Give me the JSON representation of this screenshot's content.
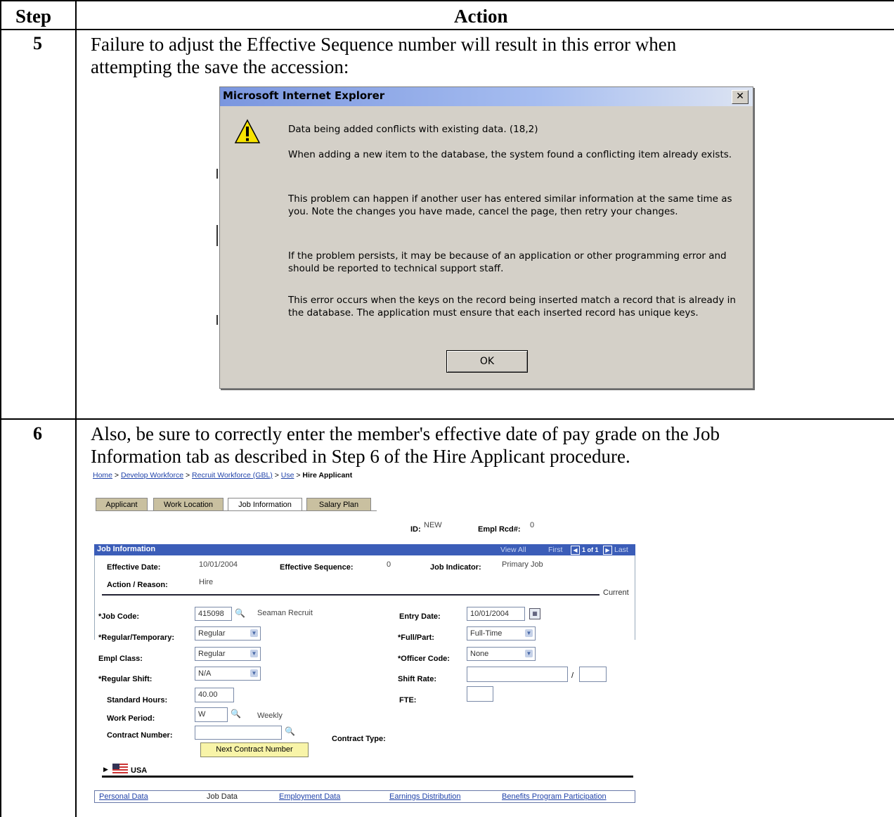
{
  "table": {
    "header_step": "Step",
    "header_action": "Action"
  },
  "row5": {
    "step": "5",
    "text_line1": "Failure to adjust the Effective Sequence number will result in this error when",
    "text_line2": "attempting the save the accession:"
  },
  "dialog": {
    "title": "Microsoft Internet Explorer",
    "close": "✕",
    "icon": "warning-icon",
    "p1": "Data being added conflicts with existing data. (18,2)",
    "p2": "When adding a new item to the database, the system found a conflicting item already exists.",
    "p3": "This problem can happen if another user has entered similar information at the same time as you.  Note the changes you have made, cancel the page, then retry your changes.",
    "p4": "If the problem persists, it may be because of an application or other programming error and should be reported to technical support staff.",
    "p5": "This error occurs when the keys on the record being inserted match a record that is already in the database.  The application must ensure that each inserted record has unique keys.",
    "ok": "OK"
  },
  "row6": {
    "step": "6",
    "text_line1": "Also, be sure to correctly enter the member's effective date of pay grade on the Job",
    "text_line2": "Information tab as described in Step 6 of the Hire Applicant procedure."
  },
  "ps": {
    "breadcrumb": {
      "home": "Home",
      "sep": " > ",
      "develop": "Develop Workforce",
      "recruit": "Recruit Workforce (GBL)",
      "use": "Use",
      "current": "Hire Applicant"
    },
    "tabs": [
      "Applicant",
      "Work Location",
      "Job Information",
      "Salary Plan"
    ],
    "id_label": "ID:",
    "id_value": "NEW",
    "rcd_label": "Empl Rcd#:",
    "rcd_value": "0",
    "section_title": "Job Information",
    "nav": {
      "view_all": "View All",
      "first": "First",
      "count": "1 of 1",
      "last": "Last"
    },
    "eff_date_label": "Effective Date:",
    "eff_date_value": "10/01/2004",
    "eff_seq_label": "Effective Sequence:",
    "eff_seq_value": "0",
    "job_ind_label": "Job Indicator:",
    "job_ind_value": "Primary Job",
    "action_label": "Action / Reason:",
    "action_value": "Hire",
    "current": "Current",
    "job_code_label": "*Job Code:",
    "job_code_value": "415098",
    "job_code_desc": "Seaman Recruit",
    "entry_date_label": "Entry Date:",
    "entry_date_value": "10/01/2004",
    "reg_temp_label": "*Regular/Temporary:",
    "reg_temp_value": "Regular",
    "full_part_label": "*Full/Part:",
    "full_part_value": "Full-Time",
    "empl_class_label": "Empl Class:",
    "empl_class_value": "Regular",
    "officer_label": "*Officer Code:",
    "officer_value": "None",
    "shift_label": "*Regular Shift:",
    "shift_value": "N/A",
    "shift_rate_label": "Shift Rate:",
    "shift_rate_sep": "/",
    "std_hours_label": "Standard Hours:",
    "std_hours_value": "40.00",
    "fte_label": "FTE:",
    "work_period_label": "Work Period:",
    "work_period_value": "W",
    "work_period_desc": "Weekly",
    "contract_num_label": "Contract Number:",
    "contract_type_label": "Contract Type:",
    "next_contract_btn": "Next Contract Number",
    "usa": "USA",
    "bottom_links": [
      "Personal Data",
      "Job Data",
      "Employment Data",
      "Earnings Distribution",
      "Benefits Program Participation"
    ]
  }
}
